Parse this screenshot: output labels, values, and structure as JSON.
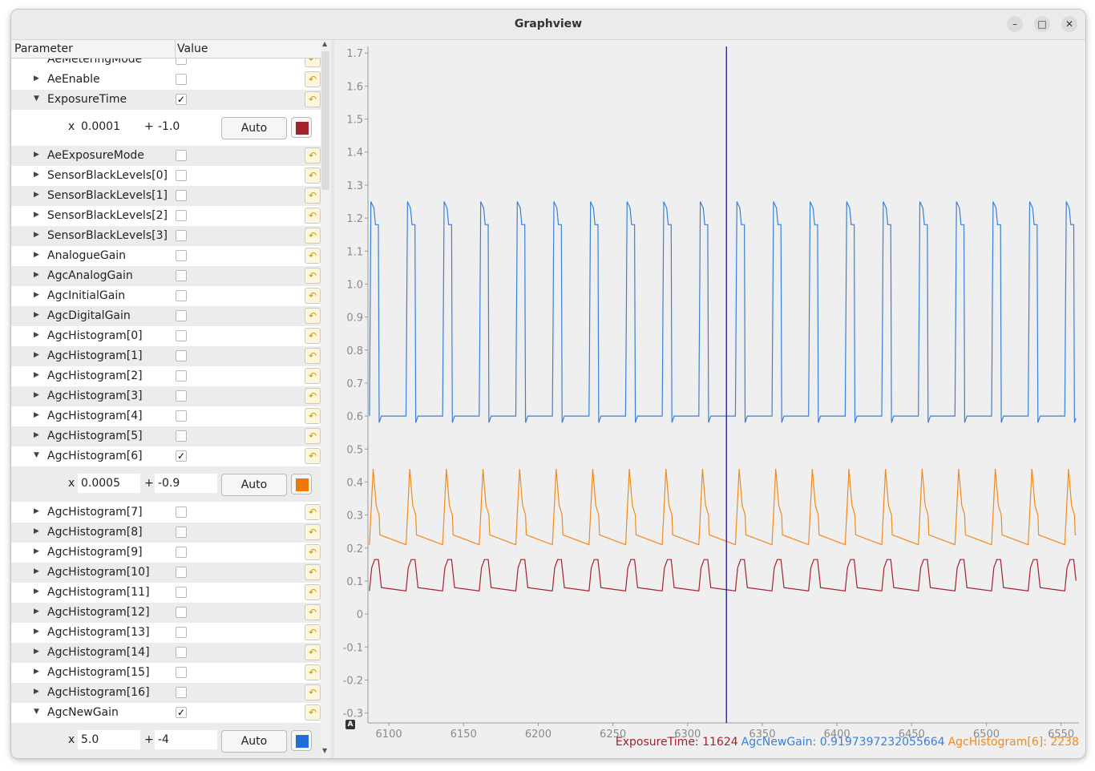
{
  "window": {
    "title": "Graphview",
    "min_icon": "minimize-icon",
    "max_icon": "maximize-icon",
    "close_icon": "close-icon"
  },
  "table": {
    "header": {
      "parameter": "Parameter",
      "value": "Value"
    },
    "partial_row": "AeMeteringMode",
    "rows": [
      {
        "name": "AeEnable",
        "checked": false
      },
      {
        "name": "ExposureTime",
        "checked": true,
        "expanded": true,
        "scale": "0.0001",
        "offset": "-1.0",
        "auto": "Auto",
        "color": "#a3202c"
      },
      {
        "name": "AeExposureMode",
        "checked": false
      },
      {
        "name": "SensorBlackLevels[0]",
        "checked": false
      },
      {
        "name": "SensorBlackLevels[1]",
        "checked": false
      },
      {
        "name": "SensorBlackLevels[2]",
        "checked": false
      },
      {
        "name": "SensorBlackLevels[3]",
        "checked": false
      },
      {
        "name": "AnalogueGain",
        "checked": false
      },
      {
        "name": "AgcAnalogGain",
        "checked": false
      },
      {
        "name": "AgcInitialGain",
        "checked": false
      },
      {
        "name": "AgcDigitalGain",
        "checked": false
      },
      {
        "name": "AgcHistogram[0]",
        "checked": false
      },
      {
        "name": "AgcHistogram[1]",
        "checked": false
      },
      {
        "name": "AgcHistogram[2]",
        "checked": false
      },
      {
        "name": "AgcHistogram[3]",
        "checked": false
      },
      {
        "name": "AgcHistogram[4]",
        "checked": false
      },
      {
        "name": "AgcHistogram[5]",
        "checked": false
      },
      {
        "name": "AgcHistogram[6]",
        "checked": true,
        "expanded": true,
        "scale": "0.0005",
        "offset": "-0.9",
        "auto": "Auto",
        "color": "#f07800"
      },
      {
        "name": "AgcHistogram[7]",
        "checked": false
      },
      {
        "name": "AgcHistogram[8]",
        "checked": false
      },
      {
        "name": "AgcHistogram[9]",
        "checked": false
      },
      {
        "name": "AgcHistogram[10]",
        "checked": false
      },
      {
        "name": "AgcHistogram[11]",
        "checked": false
      },
      {
        "name": "AgcHistogram[12]",
        "checked": false
      },
      {
        "name": "AgcHistogram[13]",
        "checked": false
      },
      {
        "name": "AgcHistogram[14]",
        "checked": false
      },
      {
        "name": "AgcHistogram[15]",
        "checked": false
      },
      {
        "name": "AgcHistogram[16]",
        "checked": false
      },
      {
        "name": "AgcNewGain",
        "checked": true,
        "expanded": true,
        "scale": "5.0",
        "offset": "-4",
        "auto": "Auto",
        "color": "#1f6fd6"
      }
    ],
    "labels": {
      "x": "x",
      "plus": "+"
    }
  },
  "plot": {
    "autoscale_badge": "A",
    "cursor_x": 6326,
    "legend": [
      {
        "text": "ExposureTime: 11624",
        "color": "#a3202c"
      },
      {
        "text": "AgcNewGain: 0.9197397232055664",
        "color": "#3a7fd8"
      },
      {
        "text": "AgcHistogram[6]: 2238",
        "color": "#f08a1c"
      }
    ]
  },
  "chart_data": {
    "type": "line",
    "xlim": [
      6086,
      6562
    ],
    "ylim": [
      -0.33,
      1.72
    ],
    "xticks": [
      6100,
      6150,
      6200,
      6250,
      6300,
      6350,
      6400,
      6450,
      6500,
      6550
    ],
    "xtick_labels": [
      "6100",
      "6150",
      "6200",
      "6250",
      "6300",
      "6350",
      "6400",
      "6450",
      "6500",
      "6550"
    ],
    "yticks": [
      -0.3,
      -0.2,
      -0.1,
      0,
      0.1,
      0.2,
      0.3,
      0.4,
      0.5,
      0.6,
      0.7,
      0.8,
      0.9,
      1.0,
      1.1,
      1.2,
      1.3,
      1.4,
      1.5,
      1.6,
      1.7
    ],
    "ytick_labels": [
      "-0.3",
      "-0.2",
      "-0.1",
      "0",
      "0.1",
      "0.2",
      "0.3",
      "0.4",
      "0.5",
      "0.6",
      "0.7",
      "0.8",
      "0.9",
      "1.0",
      "1.1",
      "1.2",
      "1.3",
      "1.4",
      "1.5",
      "1.6",
      "1.7"
    ],
    "grid": false,
    "series": [
      {
        "name": "AgcNewGain",
        "color": "#3a7fd8",
        "period": 24.5,
        "start": 6087,
        "high": 1.25,
        "low": 0.58,
        "settle_high": 1.18,
        "settle_low": 0.6,
        "end_value": 1.18
      },
      {
        "name": "AgcHistogram[6]",
        "color": "#f08a1c",
        "period": 24.5,
        "start": 6087,
        "high": 0.44,
        "low": 0.21,
        "settle_high": 0.3,
        "end_value": 0.31
      },
      {
        "name": "ExposureTime",
        "color": "#a3202c",
        "period": 24.5,
        "start": 6087,
        "high": 0.165,
        "low": 0.07,
        "end_value": 0.12
      }
    ]
  }
}
